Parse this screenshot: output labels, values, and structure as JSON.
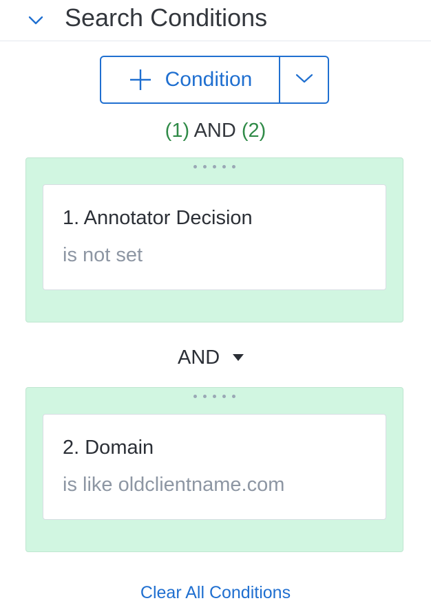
{
  "header": {
    "title": "Search Conditions",
    "collapse_icon": "chevron-down-icon"
  },
  "toolbar": {
    "add_label": "Condition",
    "add_icon": "plus-icon",
    "dropdown_icon": "chevron-down-icon"
  },
  "expression": {
    "open1": "(1)",
    "op": " AND ",
    "open2": "(2)"
  },
  "conditions": [
    {
      "title": "1. Annotator Decision",
      "description": "is not set"
    },
    {
      "title": "2. Domain",
      "description": "is like oldclientname.com"
    }
  ],
  "operator": {
    "label": "AND",
    "icon": "caret-down-icon"
  },
  "footer": {
    "clear_label": "Clear All Conditions"
  },
  "colors": {
    "accent": "#1f6fd0",
    "group_bg": "#d1f6e1",
    "expression_number": "#2f8a47"
  }
}
